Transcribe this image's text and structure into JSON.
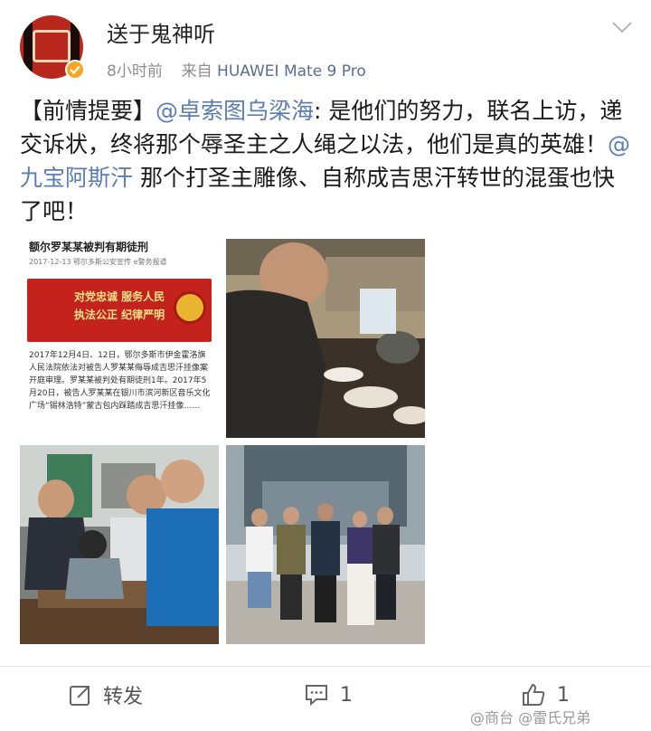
{
  "user": {
    "name": "送于鬼神听",
    "time": "8小时前",
    "source_prefix": "来自",
    "device": "HUAWEI Mate 9 Pro"
  },
  "post": {
    "p1": "【前情提要】",
    "mention1": "@卓索图乌梁海",
    "p2": ": 是他们的努力，联名上访，递交诉状，终将那个辱圣主之人绳之以法，他们是真的英雄！",
    "mention2": "@九宝阿斯汗",
    "p3": " 那个打圣主雕像、自称成吉思汗转世的混蛋也快了吧！"
  },
  "images": {
    "news": {
      "headline": "额尔罗某某被判有期徒刑",
      "meta": "2017-12-13  鄂尔多斯公安宣传  e警务报道",
      "banner_line1": "对党忠诚 服务人民",
      "banner_line2": "执法公正 纪律严明",
      "body": "2017年12月4日、12日，鄂尔多斯市伊金霍洛旗人民法院依法对被告人罗某某侮辱成吉思汗挂像案开庭审理。罗某某被判处有期徒刑1年。2017年5月20日，被告人罗某某在银川市滨河新区音乐文化广场“锡林浩特”蒙古包内踩踏成吉思汗挂像……"
    }
  },
  "actions": {
    "repost": "转发",
    "comment_count": "1",
    "like_count": "1"
  },
  "watermark": "@商台 @雷氏兄弟"
}
